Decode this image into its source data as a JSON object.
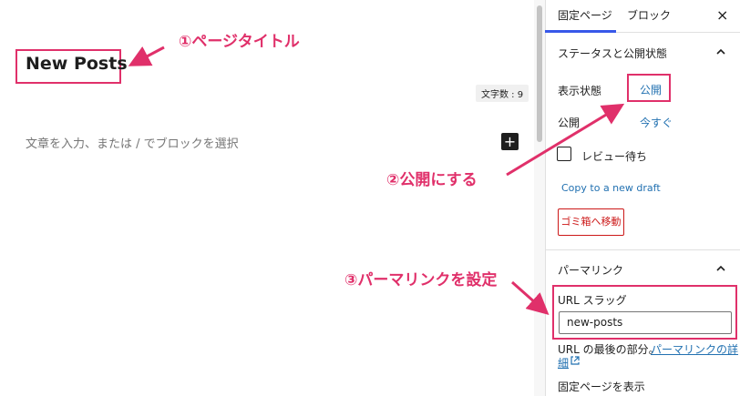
{
  "editor": {
    "post_title": "New Posts",
    "word_count": "文字数 : 9",
    "block_placeholder": "文章を入力、または / でブロックを選択",
    "inserter_symbol": "+"
  },
  "sidebar": {
    "tabs": [
      {
        "label": "固定ページ",
        "active": true
      },
      {
        "label": "ブロック",
        "active": false
      }
    ],
    "close_symbol": "×",
    "status_panel": {
      "header": "ステータスと公開状態",
      "visibility_label": "表示状態",
      "visibility_value": "公開",
      "publish_label": "公開",
      "publish_value": "今すぐ",
      "pending_review_label": "レビュー待ち",
      "copy_draft_link": "Copy to a new draft",
      "trash_button": "ゴミ箱へ移動"
    },
    "permalink_panel": {
      "header": "パーマリンク",
      "url_slug_label": "URL スラッグ",
      "url_slug_value": "new-posts",
      "help_prefix": "URL の最後の部分。",
      "help_link_line1": "パーマリンクの詳",
      "help_link_line2": "細",
      "view_page_label": "固定ページを表示"
    }
  },
  "annotations": {
    "step1": "①ページタイトル",
    "step2": "②公開にする",
    "step3": "③パーマリンクを設定"
  },
  "colors": {
    "annotation_pink": "#e0306a",
    "link_blue": "#2271b1",
    "accent_blue": "#3858e9",
    "danger_red": "#cc1818"
  }
}
